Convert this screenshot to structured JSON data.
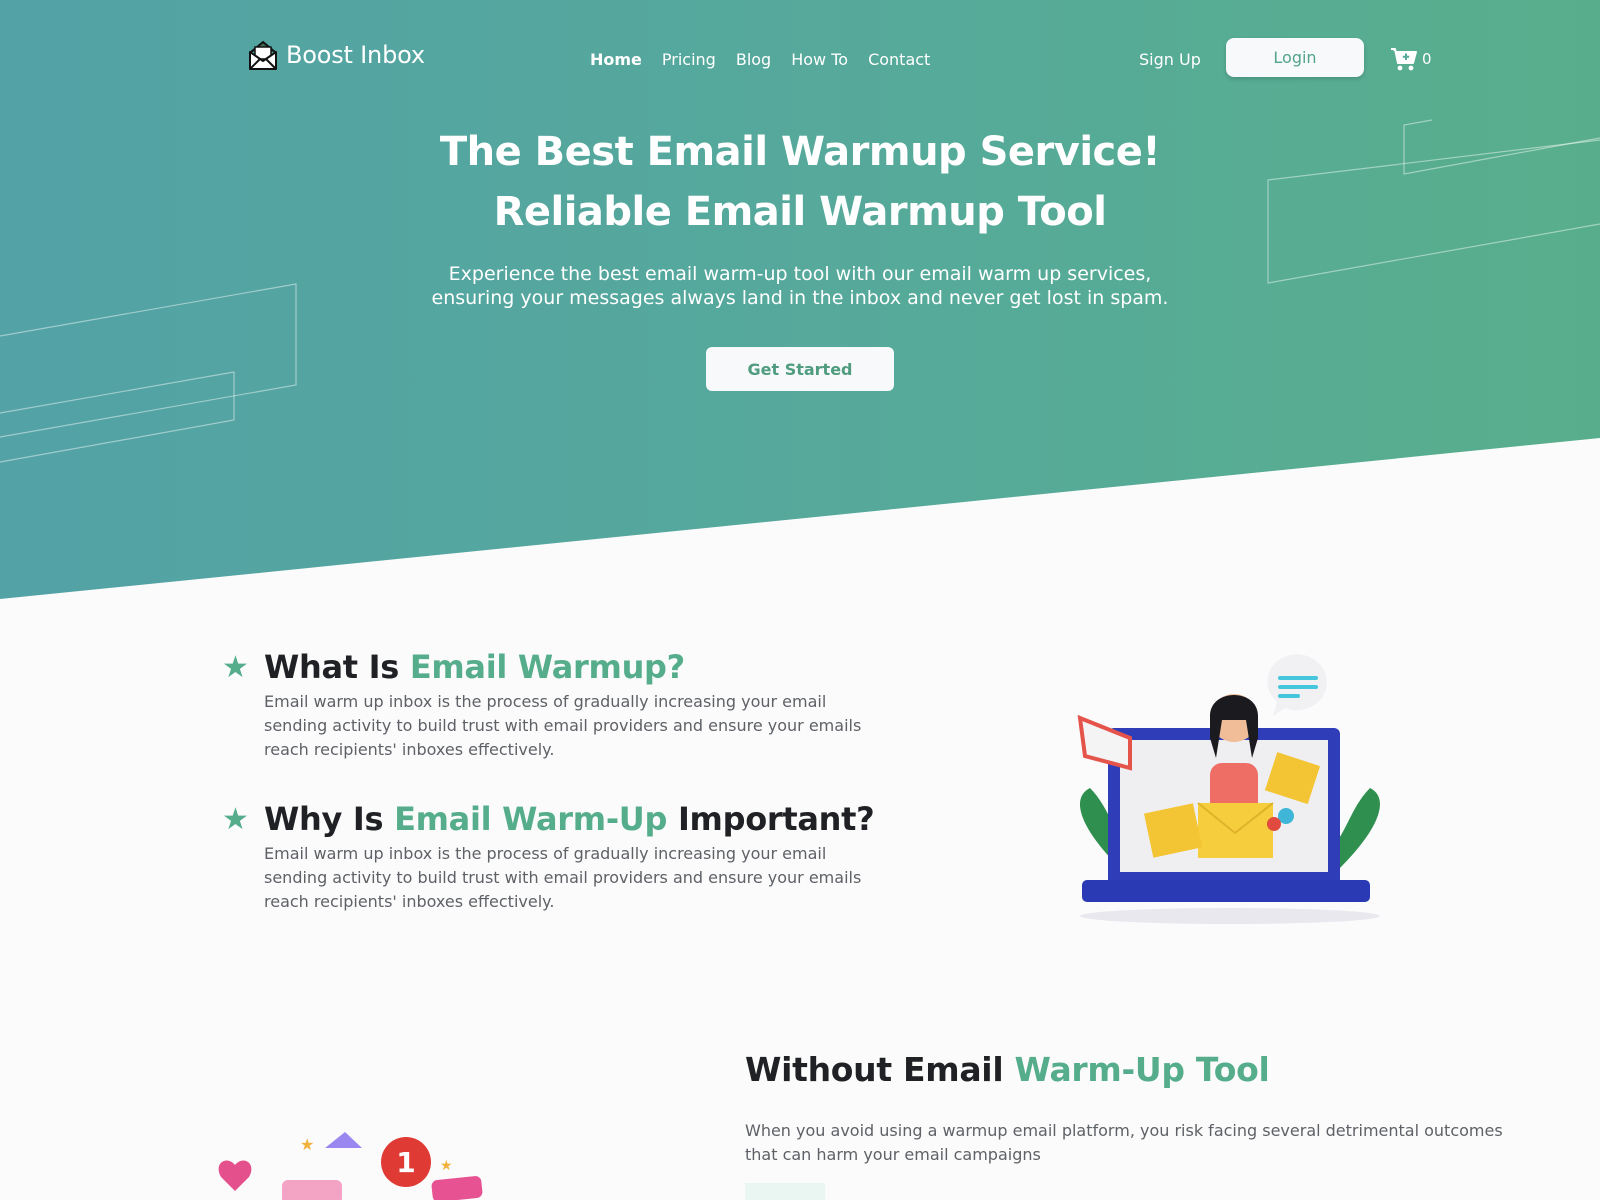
{
  "brand": {
    "name": "Boost Inbox",
    "logo_icon": "open-envelope-icon"
  },
  "nav": {
    "items": [
      {
        "label": "Home",
        "active": true
      },
      {
        "label": "Pricing",
        "active": false
      },
      {
        "label": "Blog",
        "active": false
      },
      {
        "label": "How To",
        "active": false
      },
      {
        "label": "Contact",
        "active": false
      }
    ],
    "signup_label": "Sign Up",
    "login_label": "Login",
    "cart_icon": "cart-plus-icon",
    "cart_count": "0"
  },
  "hero": {
    "title_line1": "The Best Email Warmup Service!",
    "title_line2": "Reliable Email Warmup Tool",
    "subtitle_line1": "Experience the best email warm-up tool with our email warm up services,",
    "subtitle_line2": "ensuring your messages always land in the inbox and never get lost in spam.",
    "cta_label": "Get Started"
  },
  "features": [
    {
      "icon": "star-icon",
      "title_prefix": "What Is ",
      "title_accent": "Email Warmup?",
      "title_suffix": "",
      "text": "Email warm up inbox is the process of gradually increasing your email sending activity to build trust with email providers and ensure your emails reach recipients' inboxes effectively."
    },
    {
      "icon": "star-icon",
      "title_prefix": "Why Is ",
      "title_accent": "Email Warm-Up",
      "title_suffix": " Important?",
      "text": "Email warm up inbox is the process of gradually increasing your email sending activity to build trust with email providers and ensure your emails reach recipients' inboxes effectively."
    }
  ],
  "illustration": {
    "label": "woman-with-megaphone-laptop-illustration",
    "notification_badge": "1"
  },
  "section2": {
    "title_prefix": "Without Email ",
    "title_accent": "Warm-Up Tool",
    "text": "When you avoid using a warmup email platform, you risk facing several detrimental outcomes that can harm your email campaigns"
  },
  "colors": {
    "accent": "#55ad8c",
    "hero_gradient_start": "#53a2a6",
    "hero_gradient_end": "#58ae8c",
    "heading": "#1f2124",
    "body_text": "#5e6166"
  }
}
